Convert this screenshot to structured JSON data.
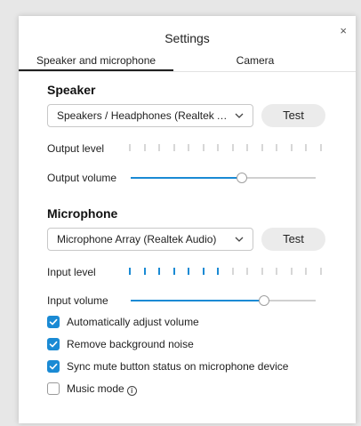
{
  "dialog": {
    "title": "Settings",
    "close_glyph": "×"
  },
  "tabs": [
    {
      "label": "Speaker and microphone",
      "active": true
    },
    {
      "label": "Camera",
      "active": false
    }
  ],
  "speaker": {
    "heading": "Speaker",
    "device": "Speakers / Headphones (Realtek Audio)",
    "test_label": "Test",
    "output_level_label": "Output level",
    "output_level_active_segments": 0,
    "output_level_total_segments": 14,
    "output_volume_label": "Output volume",
    "output_volume_fraction": 0.6
  },
  "microphone": {
    "heading": "Microphone",
    "device": "Microphone Array (Realtek Audio)",
    "test_label": "Test",
    "input_level_label": "Input level",
    "input_level_active_segments": 7,
    "input_level_total_segments": 14,
    "input_volume_label": "Input volume",
    "input_volume_fraction": 0.72
  },
  "options": [
    {
      "label": "Automatically adjust volume",
      "checked": true
    },
    {
      "label": "Remove background noise",
      "checked": true
    },
    {
      "label": "Sync mute button status on microphone device",
      "checked": true
    },
    {
      "label": "Music mode",
      "checked": false,
      "info_icon": "info-icon"
    }
  ],
  "colors": {
    "accent": "#1a8ad4",
    "meter_off": "#d7d7d7",
    "button_bg": "#ebebeb"
  },
  "icons": {
    "chevron": "chevron-down-icon",
    "close": "close-icon",
    "check": "check-icon"
  }
}
